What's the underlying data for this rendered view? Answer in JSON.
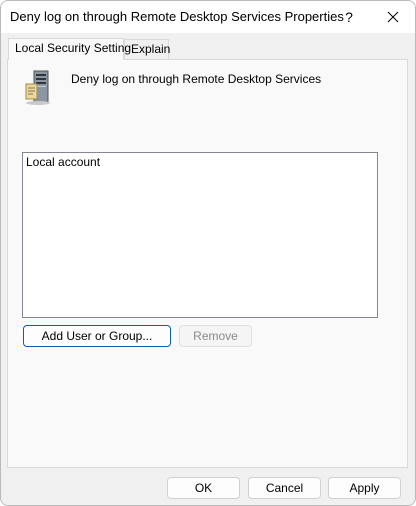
{
  "window": {
    "title": "Deny log on through Remote Desktop Services Properties",
    "help_label": "?",
    "close_icon": "close-icon"
  },
  "tabs": [
    {
      "label": "Local Security Setting",
      "active": true
    },
    {
      "label": "Explain",
      "active": false
    }
  ],
  "policy": {
    "icon": "server-icon",
    "title": "Deny log on through Remote Desktop Services"
  },
  "accounts": {
    "items": [
      "Local account"
    ]
  },
  "actions": {
    "add_label": "Add User or Group...",
    "remove_label": "Remove"
  },
  "footer": {
    "ok_label": "OK",
    "cancel_label": "Cancel",
    "apply_label": "Apply"
  },
  "colors": {
    "accent": "#005fb8",
    "dialog_background": "#f0f0f0"
  }
}
